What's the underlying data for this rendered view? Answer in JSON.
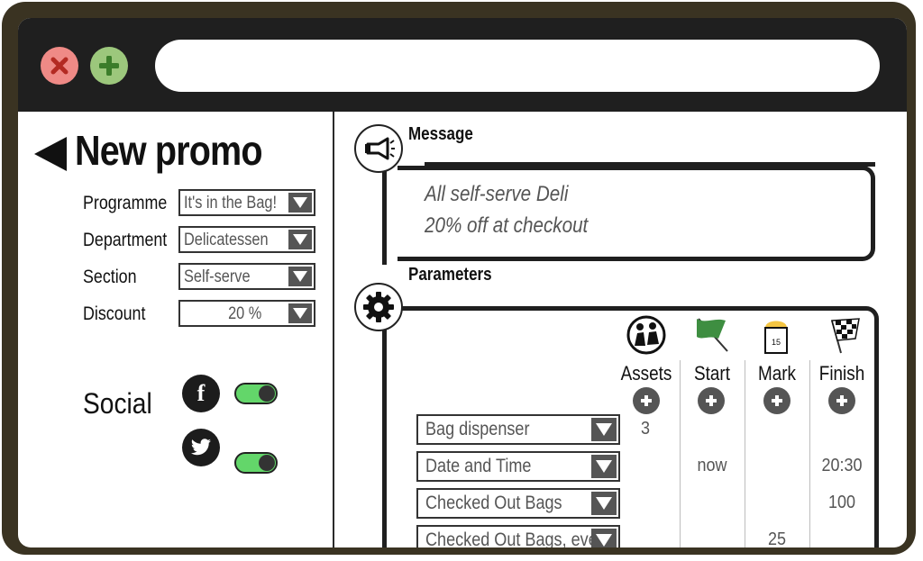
{
  "window": {
    "close_icon": "close-icon",
    "add_icon": "plus-icon",
    "colors": {
      "close": "#ef8a86",
      "add": "#9cc77c",
      "titlebar": "#1f1f1f",
      "frame": "#3a3322"
    }
  },
  "promo": {
    "title": "New promo",
    "fields": [
      {
        "label": "Programme",
        "value": "It's in the Bag!"
      },
      {
        "label": "Department",
        "value": "Delicatessen"
      },
      {
        "label": "Section",
        "value": "Self-serve"
      },
      {
        "label": "Discount",
        "value": "20 %"
      }
    ],
    "social": {
      "label": "Social",
      "networks": [
        {
          "icon": "facebook-icon",
          "enabled": true
        },
        {
          "icon": "twitter-icon",
          "enabled": true
        }
      ]
    }
  },
  "message": {
    "label": "Message",
    "icon": "megaphone-icon",
    "lines": [
      "All self-serve Deli",
      "20% off at checkout"
    ]
  },
  "parameters": {
    "label": "Parameters",
    "icon": "gear-icon",
    "columns": [
      {
        "name": "Assets",
        "icon": "people-icon"
      },
      {
        "name": "Start",
        "icon": "green-flag-icon"
      },
      {
        "name": "Mark",
        "icon": "calendar-icon",
        "icon_text": "15"
      },
      {
        "name": "Finish",
        "icon": "checkered-flag-icon"
      }
    ],
    "rows": [
      {
        "label": "Bag dispenser",
        "cells": [
          "3",
          "",
          "",
          ""
        ]
      },
      {
        "label": "Date and Time",
        "cells": [
          "",
          "now",
          "",
          "20:30"
        ]
      },
      {
        "label": "Checked Out Bags",
        "cells": [
          "",
          "",
          "",
          "100"
        ]
      },
      {
        "label": "Checked Out Bags, ever",
        "cells": [
          "",
          "",
          "25",
          ""
        ]
      }
    ]
  }
}
